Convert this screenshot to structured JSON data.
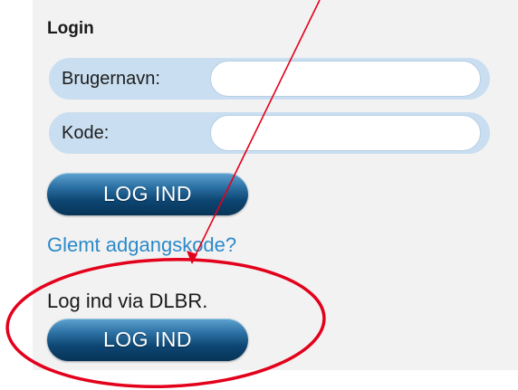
{
  "login": {
    "title": "Login",
    "username_label": "Brugernavn:",
    "password_label": "Kode:",
    "username_value": "",
    "password_value": "",
    "login_button_label": "LOG IND",
    "forgot_password_link": "Glemt adgangskode?"
  },
  "dlbr": {
    "text": "Log ind via DLBR.",
    "login_button_label": "LOG IND"
  },
  "annotation": {
    "color": "#e3001b"
  }
}
